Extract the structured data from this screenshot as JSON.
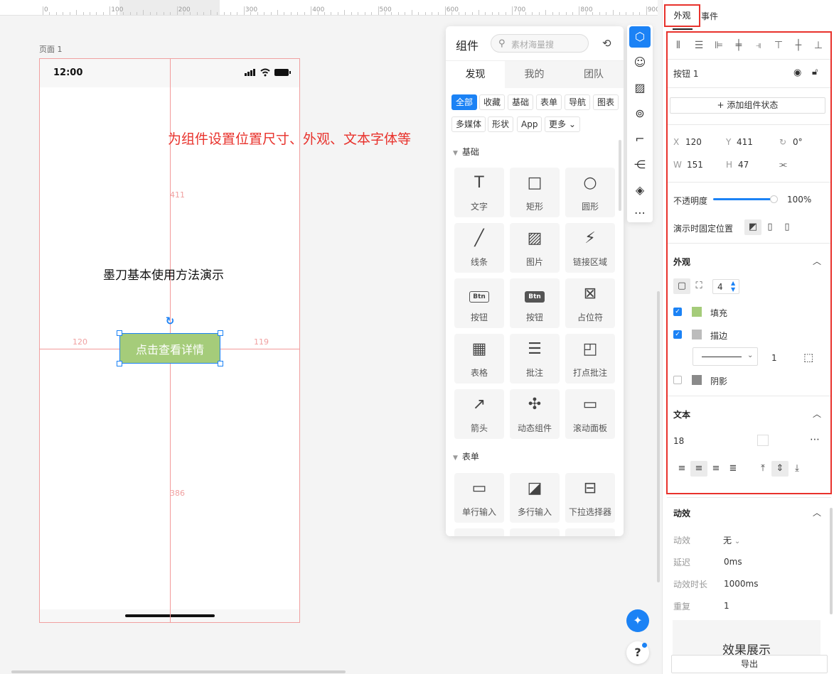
{
  "ruler": {
    "labels": [
      "0",
      "100",
      "200",
      "300",
      "400",
      "500",
      "600",
      "700",
      "800",
      "900"
    ]
  },
  "canvas": {
    "page_label": "页面 1",
    "status_time": "12:00",
    "demo_title": "墨刀基本使用方法演示",
    "annotation": "为组件设置位置尺寸、外观、文本字体等",
    "selected_button_label": "点击查看详情",
    "guide_labels": {
      "left": "120",
      "right": "119",
      "top": "411",
      "bottom": "386"
    }
  },
  "component_panel": {
    "title": "组件",
    "search_placeholder": "素材海量搜",
    "tabs": [
      "发现",
      "我的",
      "团队"
    ],
    "filter_chips_row1": [
      "全部",
      "收藏",
      "基础",
      "表单",
      "导航",
      "图表"
    ],
    "filter_chips_row2": [
      "多媒体",
      "形状",
      "App",
      "更多"
    ],
    "section_basic": "基础",
    "section_form": "表单",
    "basic_items": [
      "文字",
      "矩形",
      "圆形",
      "线条",
      "图片",
      "链接区域",
      "按钮",
      "按钮",
      "占位符",
      "表格",
      "批注",
      "打点批注",
      "箭头",
      "动态组件",
      "滚动面板"
    ],
    "form_items": [
      "单行输入",
      "多行输入",
      "下拉选择器"
    ],
    "btn_tile_text": "Btn"
  },
  "right_panel": {
    "tab_look": "外观",
    "tab_event": "事件",
    "component_name": "按钮 1",
    "add_state": "添加组件状态",
    "geometry": {
      "x_label": "X",
      "x": "120",
      "y_label": "Y",
      "y": "411",
      "rotation": "0°",
      "w_label": "W",
      "w": "151",
      "h_label": "H",
      "h": "47"
    },
    "opacity_label": "不透明度",
    "opacity_value": "100%",
    "opacity_level": 1.0,
    "fixed_position_label": "演示时固定位置",
    "appearance_title": "外观",
    "corner_radius": "4",
    "fill_label": "填充",
    "stroke_label": "描边",
    "stroke_width": "1",
    "shadow_label": "阴影",
    "text_title": "文本",
    "font_size": "18",
    "animation_title": "动效",
    "anim_effect_label": "动效",
    "anim_effect_value": "无",
    "delay_label": "延迟",
    "delay_value": "0ms",
    "duration_label": "动效时长",
    "duration_value": "1000ms",
    "repeat_label": "重复",
    "repeat_value": "1",
    "preview_text": "效果展示",
    "export_label": "导出"
  },
  "colors": {
    "accent": "#1b82f5",
    "annotation_red": "#e8322c",
    "button_fill": "#a5cc7a",
    "guide": "#f39a9a"
  }
}
